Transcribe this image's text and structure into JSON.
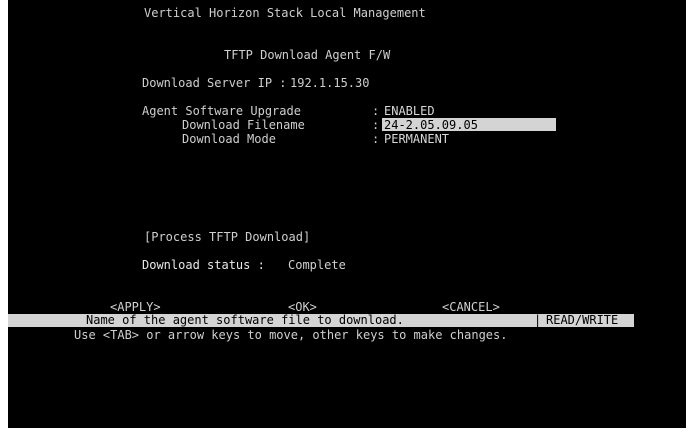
{
  "header": {
    "title": "Vertical Horizon Stack Local Management",
    "screen_title": "TFTP Download Agent F/W"
  },
  "server": {
    "label": "Download Server IP :",
    "value": "192.1.15.30"
  },
  "fields": [
    {
      "label": "Agent Software Upgrade",
      "sep": ":",
      "value": "ENABLED",
      "highlighted": false
    },
    {
      "label": "Download Filename",
      "sep": ":",
      "value": "24-2.05.09.05",
      "highlighted": true
    },
    {
      "label": "Download Mode",
      "sep": ":",
      "value": "PERMANENT",
      "highlighted": false
    }
  ],
  "actions": {
    "process": "[Process TFTP Download]",
    "apply": "<APPLY>",
    "ok": "<OK>",
    "cancel": "<CANCEL>"
  },
  "download_status": {
    "label": "Download status :",
    "value": "Complete"
  },
  "status_bar": {
    "message": "Name of the agent software file to download.",
    "divider": "|",
    "mode": "READ/WRITE"
  },
  "hint": "Use <TAB> or arrow keys to move, other keys to make changes.",
  "colors": {
    "background": "#000000",
    "text": "#cfcfcf",
    "highlight_bg": "#d4d4d4",
    "highlight_fg": "#000000"
  }
}
